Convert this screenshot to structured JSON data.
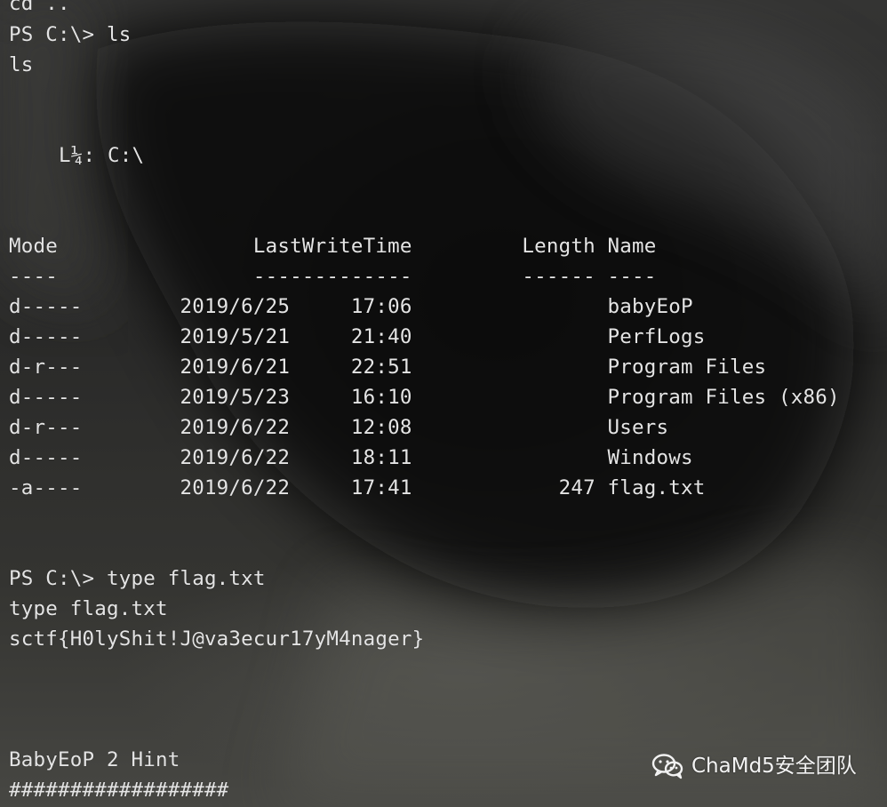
{
  "terminal": {
    "lines": [
      "cd ..",
      "PS C:\\> ls",
      "ls",
      "L¼: C:\\",
      "Mode                LastWriteTime         Length Name",
      "----                -------------         ------ ----",
      "d-----        2019/6/25     17:06                babyEoP",
      "d-----        2019/5/21     21:40                PerfLogs",
      "d-r---        2019/6/21     22:51                Program Files",
      "d-----        2019/5/23     16:10                Program Files (x86)",
      "d-r---        2019/6/22     12:08                Users",
      "d-----        2019/6/22     18:11                Windows",
      "-a----        2019/6/22     17:41            247 flag.txt",
      "PS C:\\> type flag.txt",
      "type flag.txt",
      "sctf{H0lyShit!J@va3ecur17yM4nager}",
      "BabyEoP 2 Hint",
      "##################"
    ]
  },
  "watermark": {
    "icon": "wechat-icon",
    "text": "ChaMd5安全团队"
  },
  "colors": {
    "text": "#e4e4e4",
    "background_dark": "#2a2a29",
    "background_light": "#474743",
    "watermark": "#f3f3f3"
  }
}
